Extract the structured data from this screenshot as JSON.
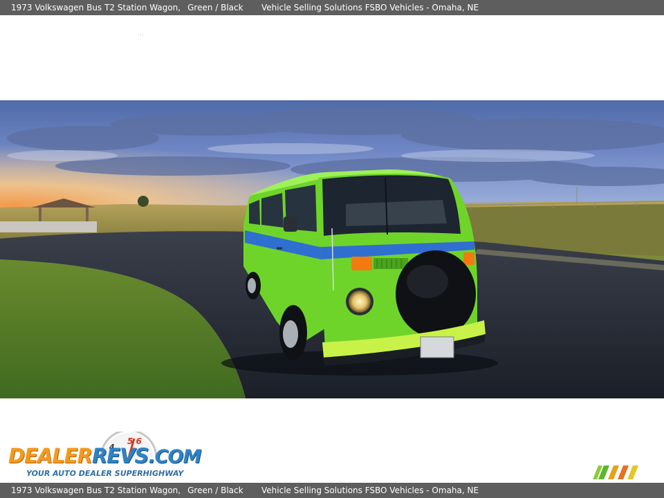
{
  "header": {
    "vehicle_title": "1973 Volkswagen Bus T2 Station Wagon,",
    "vehicle_colors": "Green / Black",
    "dealer_location": "Vehicle Selling Solutions FSBO Vehicles - Omaha, NE"
  },
  "footer": {
    "vehicle_title": "1973 Volkswagen Bus T2 Station Wagon,",
    "vehicle_colors": "Green / Black",
    "dealer_location": "Vehicle Selling Solutions FSBO Vehicles - Omaha, NE"
  },
  "logo": {
    "word_dealer": "DEALER",
    "word_revs": "REVS",
    "word_com": ".COM",
    "tagline": "YOUR AUTO DEALER SUPERHIGHWAY",
    "gauge_digits": "5 6",
    "gauge_digit_a": "4"
  },
  "loading_indicator": "...",
  "colors": {
    "bar_background": "#5e5e5e",
    "bus_green": "#6fd42a",
    "bus_stripe": "#2f6fcf",
    "logo_orange": "#f39a1e",
    "logo_blue": "#2f83c5"
  },
  "icons": {
    "spare_tire": "tire-icon",
    "brand_stripes": "stripes-icon"
  }
}
